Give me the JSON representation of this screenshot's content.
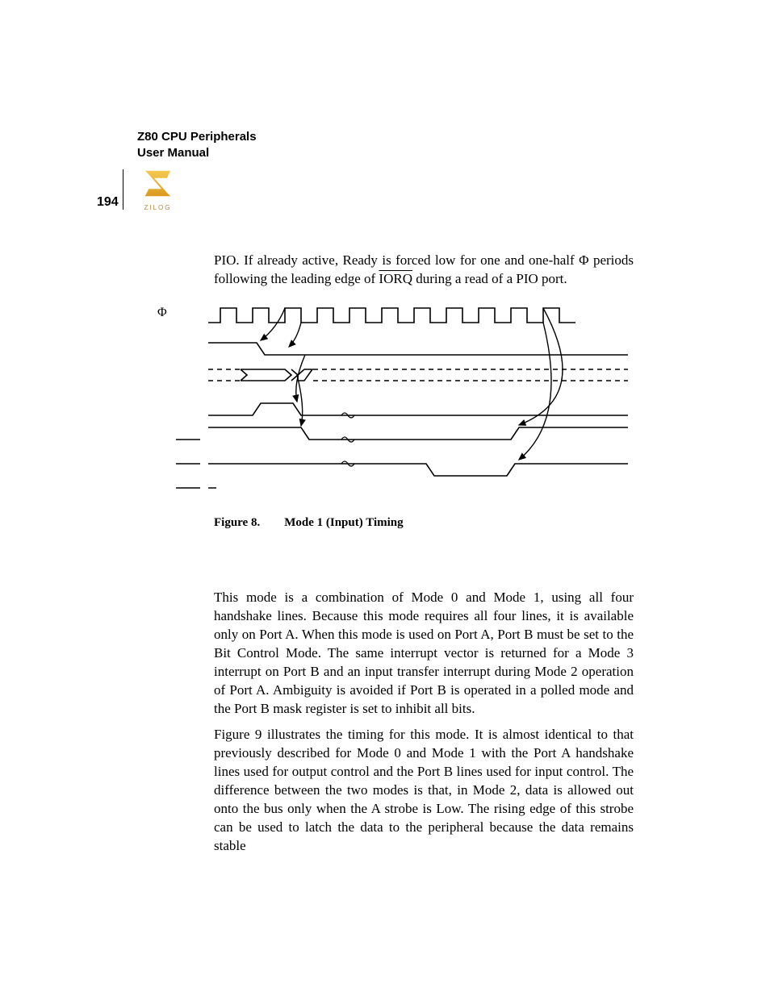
{
  "header": {
    "title_line1": "Z80 CPU Peripherals",
    "title_line2": "User Manual",
    "page_number": "194",
    "logo_caption": "ZILOG"
  },
  "paragraphs": {
    "intro_1": "PIO. If already active, Ready is forced low for one and one-half Φ periods following the leading edge of ",
    "intro_iorq": "IORQ",
    "intro_2": " during a read of a PIO port."
  },
  "figure": {
    "label": "Figure 8.",
    "title": "Mode 1 (Input) Timing",
    "phi_symbol": "Φ"
  },
  "body": {
    "p1": "This mode is a combination of Mode 0 and Mode 1, using all four handshake lines. Because this mode requires all four lines, it is available only on Port A. When this mode is used on Port A, Port B must be set to the Bit Control Mode. The same interrupt vector is returned for a Mode 3 interrupt on Port B and an input transfer interrupt during Mode 2 operation of Port A. Ambiguity is avoided if Port B is operated in a polled mode and the Port B mask register is set to inhibit all bits.",
    "p2": "Figure 9 illustrates the timing for this mode. It is almost identical to that previously described for Mode 0 and Mode 1 with the Port A handshake lines used for output control and the Port B lines used for input control. The difference between the two modes is that, in Mode 2, data is allowed out onto the bus only when the A strobe is Low. The rising edge of this strobe can be used to latch the data to the peripheral because the data remains stable"
  }
}
